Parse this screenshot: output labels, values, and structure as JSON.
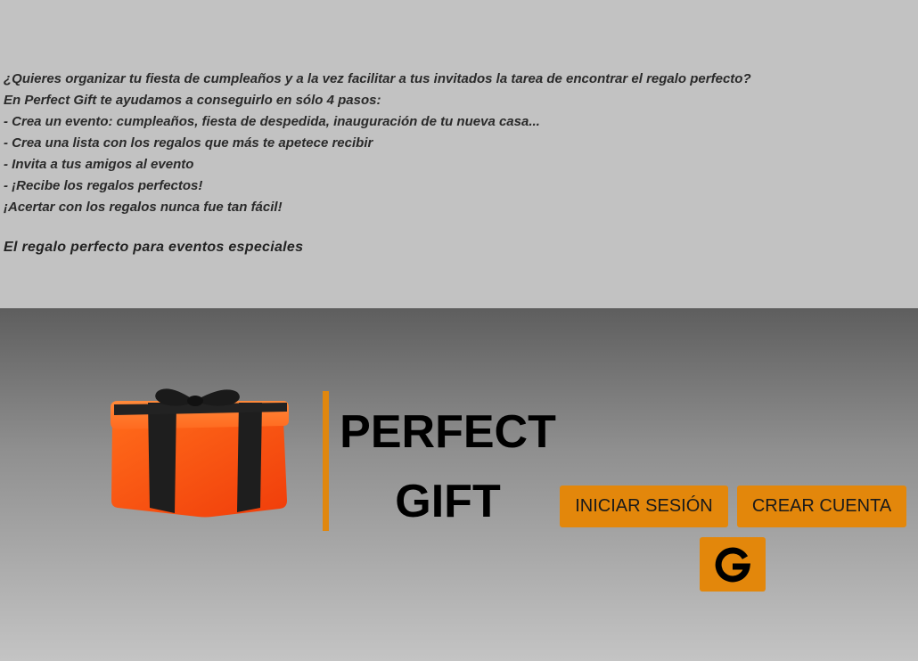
{
  "intro": {
    "lines": [
      "¿Quieres organizar tu fiesta de cumpleaños y a la vez facilitar a tus invitados la tarea de encontrar el regalo perfecto?",
      "En Perfect Gift te ayudamos a conseguirlo en sólo 4 pasos:",
      "- Crea un evento: cumpleaños, fiesta de despedida, inauguración de tu nueva casa...",
      "- Crea una lista con los regalos que más te apetece recibir",
      "- Invita a tus amigos al evento",
      "- ¡Recibe los regalos perfectos!",
      "¡Acertar con los regalos nunca fue tan fácil!"
    ],
    "tagline": "El regalo perfecto para eventos especiales"
  },
  "brand": {
    "line1": "PERFECT",
    "line2": "GIFT",
    "accent_color": "#e3870b",
    "logo_icon": "gift-box-icon"
  },
  "actions": {
    "login_label": "INICIAR SESIÓN",
    "register_label": "CREAR CUENTA",
    "google_icon": "google-g-icon"
  }
}
